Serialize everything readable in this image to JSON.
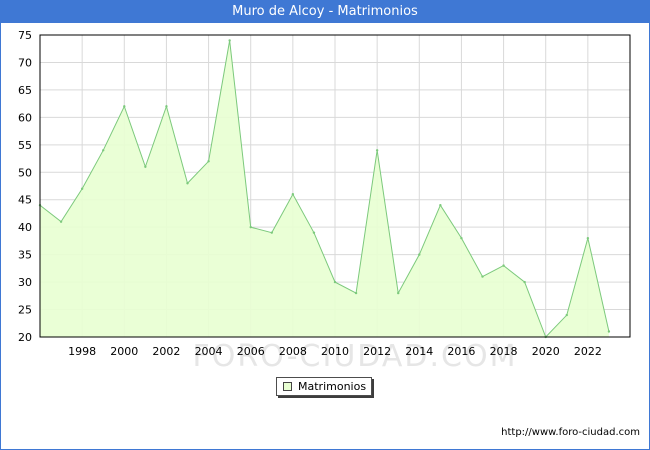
{
  "header": {
    "title": "Muro de Alcoy - Matrimonios"
  },
  "watermark": "FORO-CIUDAD.COM",
  "source": "http://www.foro-ciudad.com",
  "legend": {
    "label": "Matrimonios"
  },
  "colors": {
    "header_bg": "#3f78d4",
    "area_fill": "#e8ffd2",
    "area_line": "#7cc97c",
    "grid": "#d9d9d9"
  },
  "chart_data": {
    "type": "area",
    "title": "Muro de Alcoy - Matrimonios",
    "xlabel": "",
    "ylabel": "",
    "x": [
      1996,
      1997,
      1998,
      1999,
      2000,
      2001,
      2002,
      2003,
      2004,
      2005,
      2006,
      2007,
      2008,
      2009,
      2010,
      2011,
      2012,
      2013,
      2014,
      2015,
      2016,
      2017,
      2018,
      2019,
      2020,
      2021,
      2022,
      2023
    ],
    "series": [
      {
        "name": "Matrimonios",
        "values": [
          44,
          41,
          47,
          54,
          62,
          51,
          62,
          48,
          52,
          74,
          40,
          39,
          46,
          39,
          30,
          28,
          54,
          28,
          35,
          44,
          38,
          31,
          33,
          30,
          20,
          24,
          38,
          21
        ]
      }
    ],
    "xlim": [
      1996,
      2024
    ],
    "ylim": [
      20,
      75
    ],
    "x_ticks": [
      1998,
      2000,
      2002,
      2004,
      2006,
      2008,
      2010,
      2012,
      2014,
      2016,
      2018,
      2020,
      2022
    ],
    "y_ticks": [
      20,
      25,
      30,
      35,
      40,
      45,
      50,
      55,
      60,
      65,
      70,
      75
    ],
    "grid": true,
    "legend_position": "bottom-center"
  }
}
